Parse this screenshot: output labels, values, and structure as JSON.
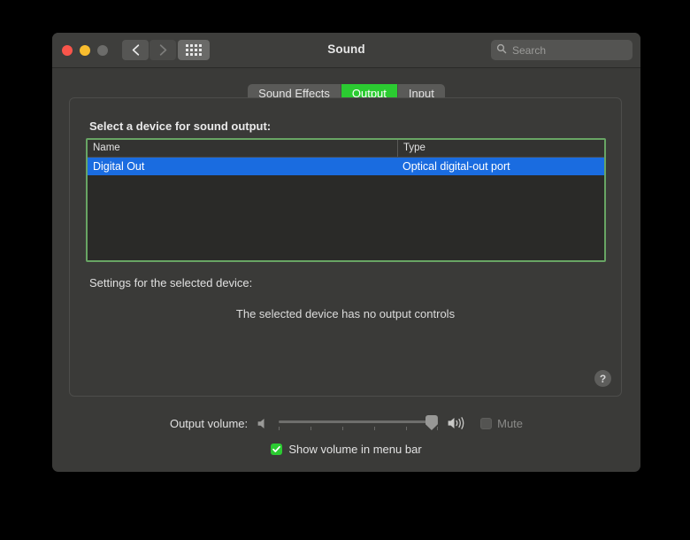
{
  "window": {
    "title": "Sound",
    "traffic_lights": {
      "close": "close-button",
      "minimize": "minimize-button",
      "zoom": "zoom-button"
    },
    "nav": {
      "back_icon": "chevron-left-icon",
      "forward_icon": "chevron-right-icon",
      "show_all_icon": "grid-dots-icon"
    },
    "search": {
      "placeholder": "Search",
      "value": "",
      "icon": "search-icon"
    }
  },
  "tabs": [
    {
      "label": "Sound Effects",
      "selected": false
    },
    {
      "label": "Output",
      "selected": true
    },
    {
      "label": "Input",
      "selected": false
    }
  ],
  "main": {
    "section_label": "Select a device for sound output:",
    "table": {
      "columns": [
        "Name",
        "Type"
      ],
      "rows": [
        {
          "name": "Digital Out",
          "type": "Optical digital-out port",
          "selected": true
        }
      ]
    },
    "settings_label": "Settings for the selected device:",
    "no_controls_message": "The selected device has no output controls",
    "help_button": "?"
  },
  "footer": {
    "volume_label": "Output volume:",
    "volume_low_icon": "speaker-low-icon",
    "volume_high_icon": "speaker-high-icon",
    "slider_value_percent": 96,
    "mute": {
      "label": "Mute",
      "checked": false,
      "enabled": false
    },
    "show_volume_in_menu_bar": {
      "label": "Show volume in menu bar",
      "checked": true
    }
  },
  "colors": {
    "accent_green": "#2bcb31",
    "selection_blue": "#1a6ce0",
    "window_bg": "#3a3a38",
    "titlebar_bg": "#3e3e3c",
    "table_bg": "#2a2a28",
    "table_focus_border": "#68a564"
  }
}
